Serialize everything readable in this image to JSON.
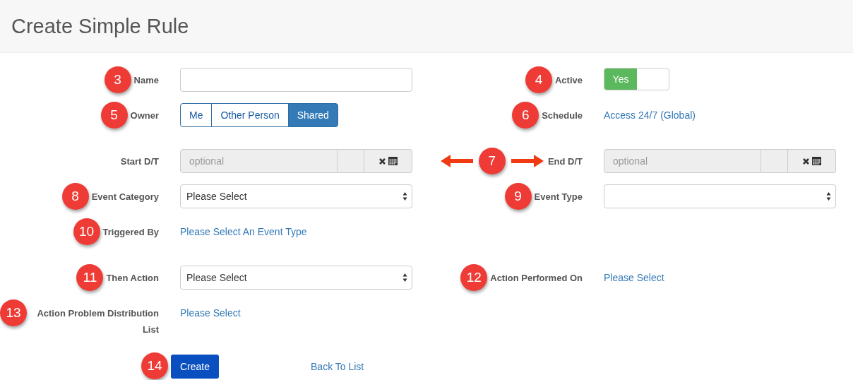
{
  "page_title": "Create Simple Rule",
  "sections": [
    [
      {
        "left": {
          "badge": "3",
          "label": "Name",
          "kind": "text_input"
        },
        "right": {
          "badge": "4",
          "label": "Active",
          "kind": "toggle",
          "on": true,
          "on_label": "Yes"
        }
      },
      {
        "left": {
          "badge": "5",
          "label": "Owner",
          "kind": "button_group",
          "options": [
            {
              "label": "Me",
              "selected": false
            },
            {
              "label": "Other Person",
              "selected": false
            },
            {
              "label": "Shared",
              "selected": true
            }
          ]
        },
        "right": {
          "badge": "6",
          "label": "Schedule",
          "kind": "link",
          "text": "Access 24/7 (Global)"
        }
      }
    ],
    [
      {
        "left": {
          "label": "Start D/T",
          "kind": "datetime",
          "placeholder": "optional"
        },
        "right": {
          "badge": "7",
          "arrows": true,
          "label": "End D/T",
          "kind": "datetime",
          "placeholder": "optional"
        }
      },
      {
        "left": {
          "badge": "8",
          "label": "Event Category",
          "kind": "select",
          "value": "Please Select"
        },
        "right": {
          "badge": "9",
          "label": "Event Type",
          "kind": "select"
        }
      },
      {
        "left": {
          "badge": "10",
          "label": "Triggered By",
          "kind": "link",
          "text": "Please Select An Event Type"
        }
      }
    ],
    [
      {
        "left": {
          "badge": "11",
          "label": "Then Action",
          "kind": "select",
          "value": "Please Select"
        },
        "right": {
          "badge": "12",
          "label": "Action Performed On",
          "kind": "link",
          "text": "Please Select"
        }
      },
      {
        "left": {
          "badge": "13",
          "label": "Action Problem Distribution List",
          "kind": "link",
          "text": "Please Select"
        }
      }
    ]
  ],
  "footer": {
    "badge": "14",
    "create_button": "Create",
    "back_link": "Back To List"
  }
}
